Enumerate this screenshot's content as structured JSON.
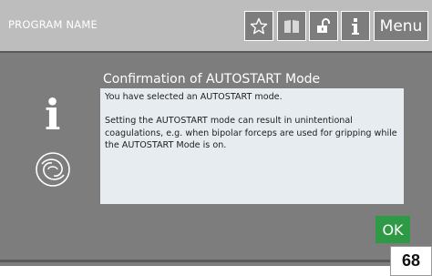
{
  "header": {
    "program_name": "PROGRAM NAME",
    "menu_label": "Menu",
    "icons": [
      "star-icon",
      "book-icon",
      "unlock-icon",
      "info-icon"
    ]
  },
  "dialog": {
    "title": "Confirmation of AUTOSTART Mode",
    "paragraphs": [
      "You have selected an AUTOSTART mode.",
      "Setting the AUTOSTART mode can result in unintentional coagulations, e.g. when bipolar forceps are used for gripping while the AUTOSTART Mode is on."
    ],
    "ok_label": "OK",
    "info_glyph": "i"
  },
  "page_number": "68",
  "colors": {
    "topbar": "#bdbdbd",
    "background": "#7d7d7d",
    "message_box": "#e6ecef",
    "ok_button": "#2f9a46"
  }
}
